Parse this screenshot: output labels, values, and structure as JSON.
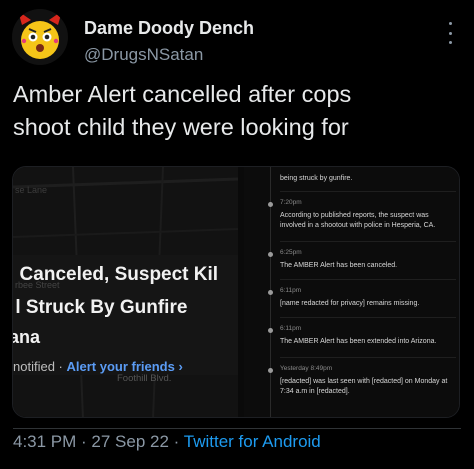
{
  "author": {
    "display_name": "Dame Doody Dench",
    "handle": "@DrugsNSatan"
  },
  "tweet": {
    "text_line1": "Amber Alert cancelled after cops",
    "text_line2": "shoot child they were looking for"
  },
  "media": {
    "map_labels": {
      "lane": "se Lane",
      "street": "rbee Street",
      "foothill": "Foothill Blvd."
    },
    "alert_card": {
      "line1": ". Canceled, Suspect Kil",
      "line2": "·l Struck By Gunfire",
      "line3": "ana",
      "notified_prefix": "notified · ",
      "notified_link": "Alert your friends ›"
    },
    "timeline": [
      {
        "time": "",
        "text": "being struck by gunfire."
      },
      {
        "time": "7:20pm",
        "text": "According to published reports, the suspect was involved in a shootout with police in Hesperia, CA."
      },
      {
        "time": "6:25pm",
        "text": "The AMBER Alert has been canceled."
      },
      {
        "time": "6:11pm",
        "text": "[name redacted for privacy] remains missing."
      },
      {
        "time": "6:11pm",
        "text": "The AMBER Alert has been extended into Arizona."
      },
      {
        "time": "Yesterday 8:49pm",
        "text": "[redacted] was last seen with [redacted] on Monday at 7:34 a.m in [redacted]."
      }
    ]
  },
  "footer": {
    "time": "4:31 PM",
    "sep1": " · ",
    "date": "27 Sep 22",
    "sep2": " · ",
    "source": "Twitter for Android"
  },
  "colors": {
    "background": "#000000",
    "link": "#1d9bf0",
    "secondary_text": "#8b98a5",
    "avatar_yellow": "#f5c518",
    "avatar_red": "#d7261c"
  }
}
